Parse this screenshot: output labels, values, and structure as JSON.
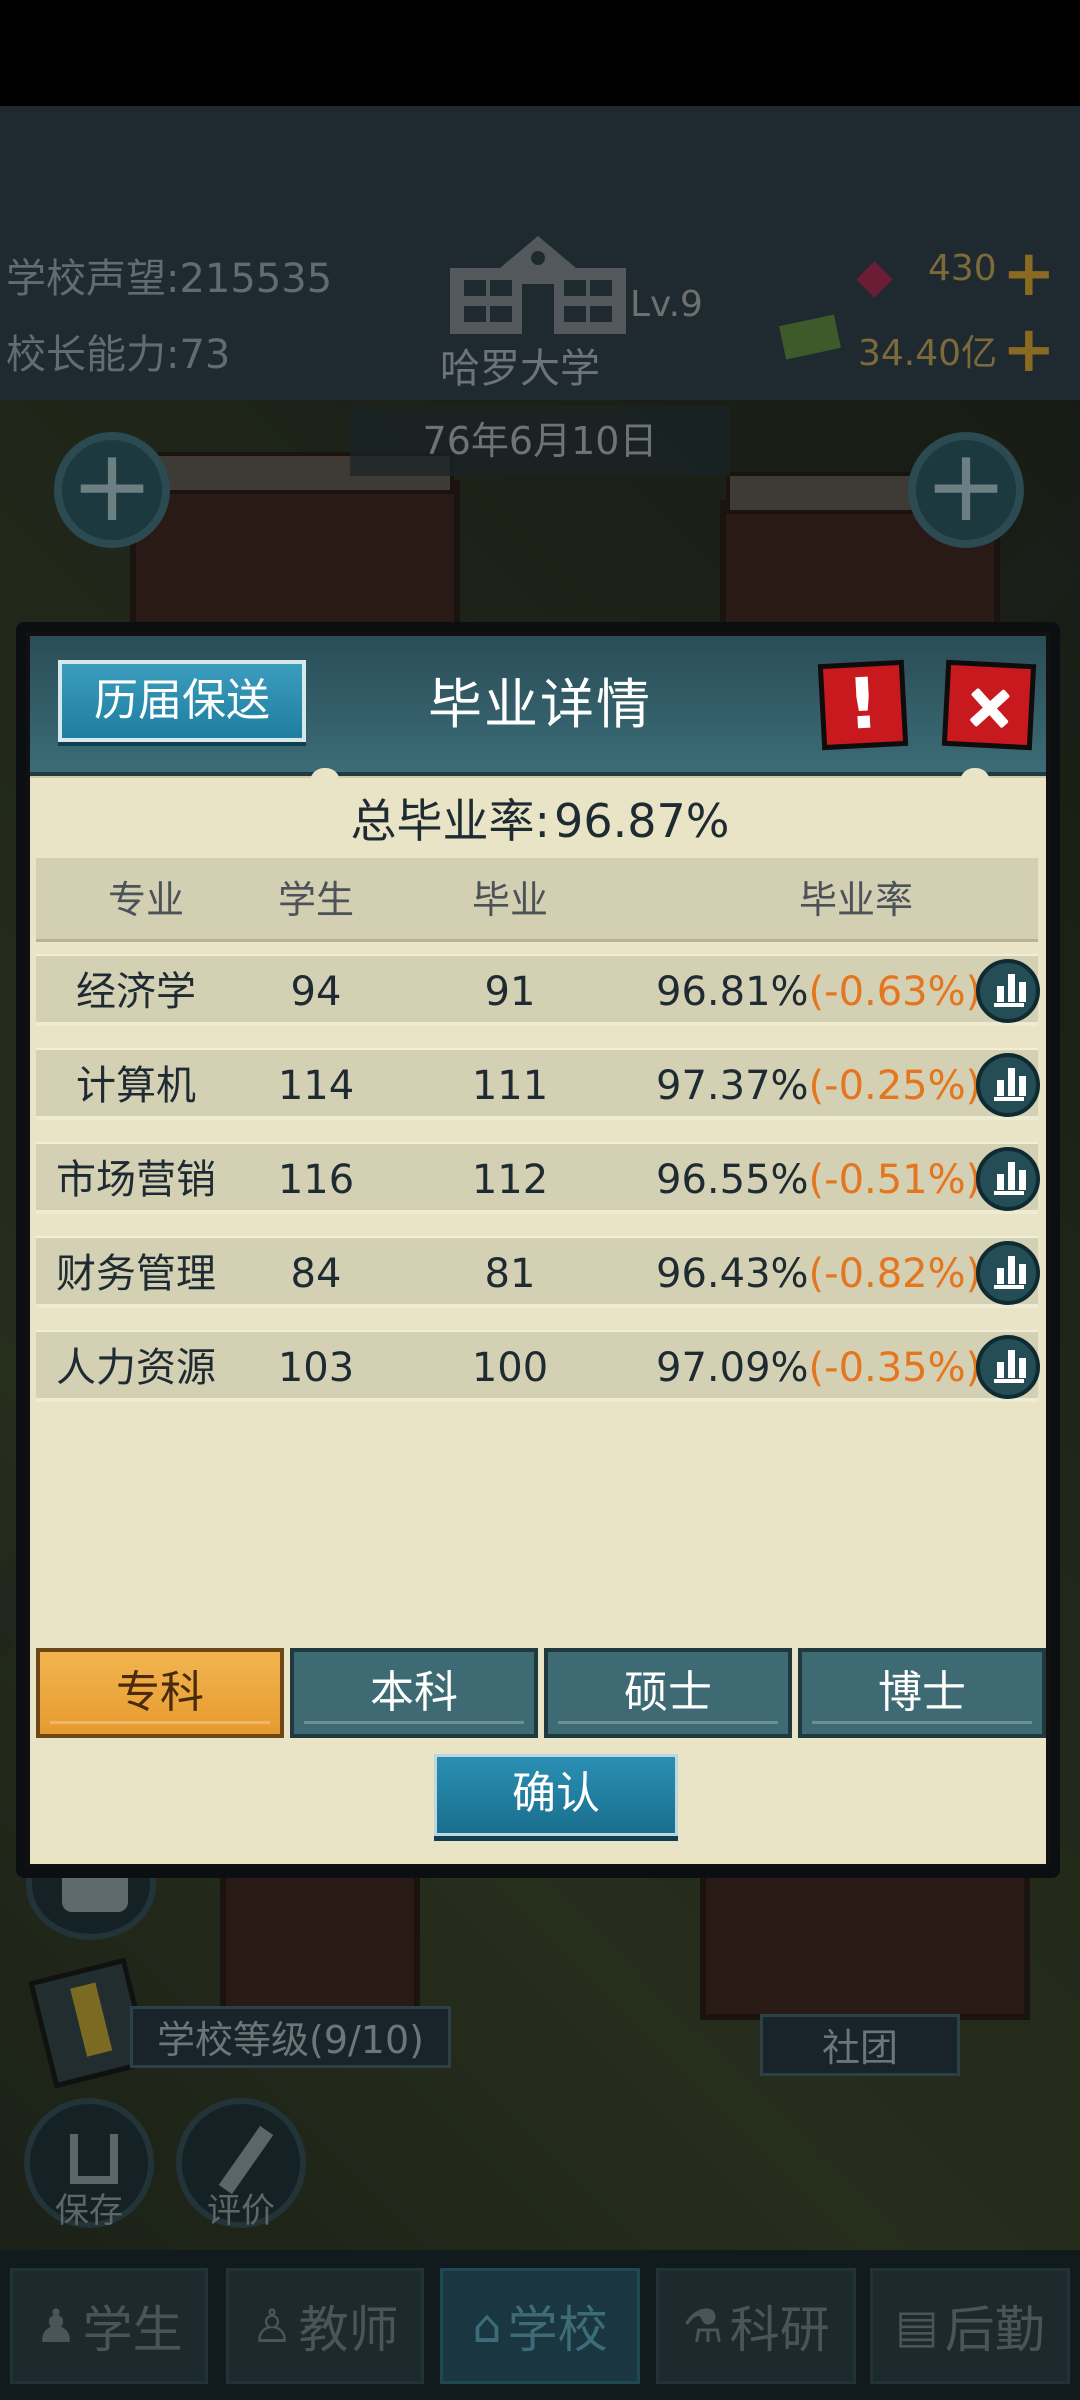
{
  "hud": {
    "reputation_label": "学校声望:",
    "reputation_value": "215535",
    "ability_label": "校长能力:",
    "ability_value": "73",
    "school_name": "哈罗大学",
    "level": "Lv.9",
    "gems": "430",
    "money": "34.40亿",
    "date": "76年6月10日"
  },
  "scene": {
    "school_grade": "学校等级(9/10)",
    "club": "社团",
    "save": "保存",
    "review": "评价"
  },
  "nav": [
    {
      "label": "学生",
      "icon": "student-icon"
    },
    {
      "label": "教师",
      "icon": "teacher-icon"
    },
    {
      "label": "学校",
      "icon": "school-icon"
    },
    {
      "label": "科研",
      "icon": "research-icon"
    },
    {
      "label": "后勤",
      "icon": "logistics-icon"
    }
  ],
  "modal": {
    "history_button": "历届保送",
    "title": "毕业详情",
    "info_button": "!",
    "total_rate_label": "总毕业率:",
    "total_rate_value": "96.87%",
    "columns": [
      "专业",
      "学生",
      "毕业",
      "毕业率"
    ],
    "rows": [
      {
        "major": "经济学",
        "students": "94",
        "graduates": "91",
        "rate": "96.81%",
        "delta": "(-0.63%)"
      },
      {
        "major": "计算机",
        "students": "114",
        "graduates": "111",
        "rate": "97.37%",
        "delta": "(-0.25%)"
      },
      {
        "major": "市场营销",
        "students": "116",
        "graduates": "112",
        "rate": "96.55%",
        "delta": "(-0.51%)"
      },
      {
        "major": "财务管理",
        "students": "84",
        "graduates": "81",
        "rate": "96.43%",
        "delta": "(-0.82%)"
      },
      {
        "major": "人力资源",
        "students": "103",
        "graduates": "100",
        "rate": "97.09%",
        "delta": "(-0.35%)"
      }
    ],
    "tabs": [
      "专科",
      "本科",
      "硕士",
      "博士"
    ],
    "active_tab": "专科",
    "confirm_button": "确认"
  },
  "colors": {
    "delta": "#e4761f",
    "header": "#3b6c77",
    "active_tab": "#e69b2f",
    "alert_red": "#c81a1e"
  }
}
